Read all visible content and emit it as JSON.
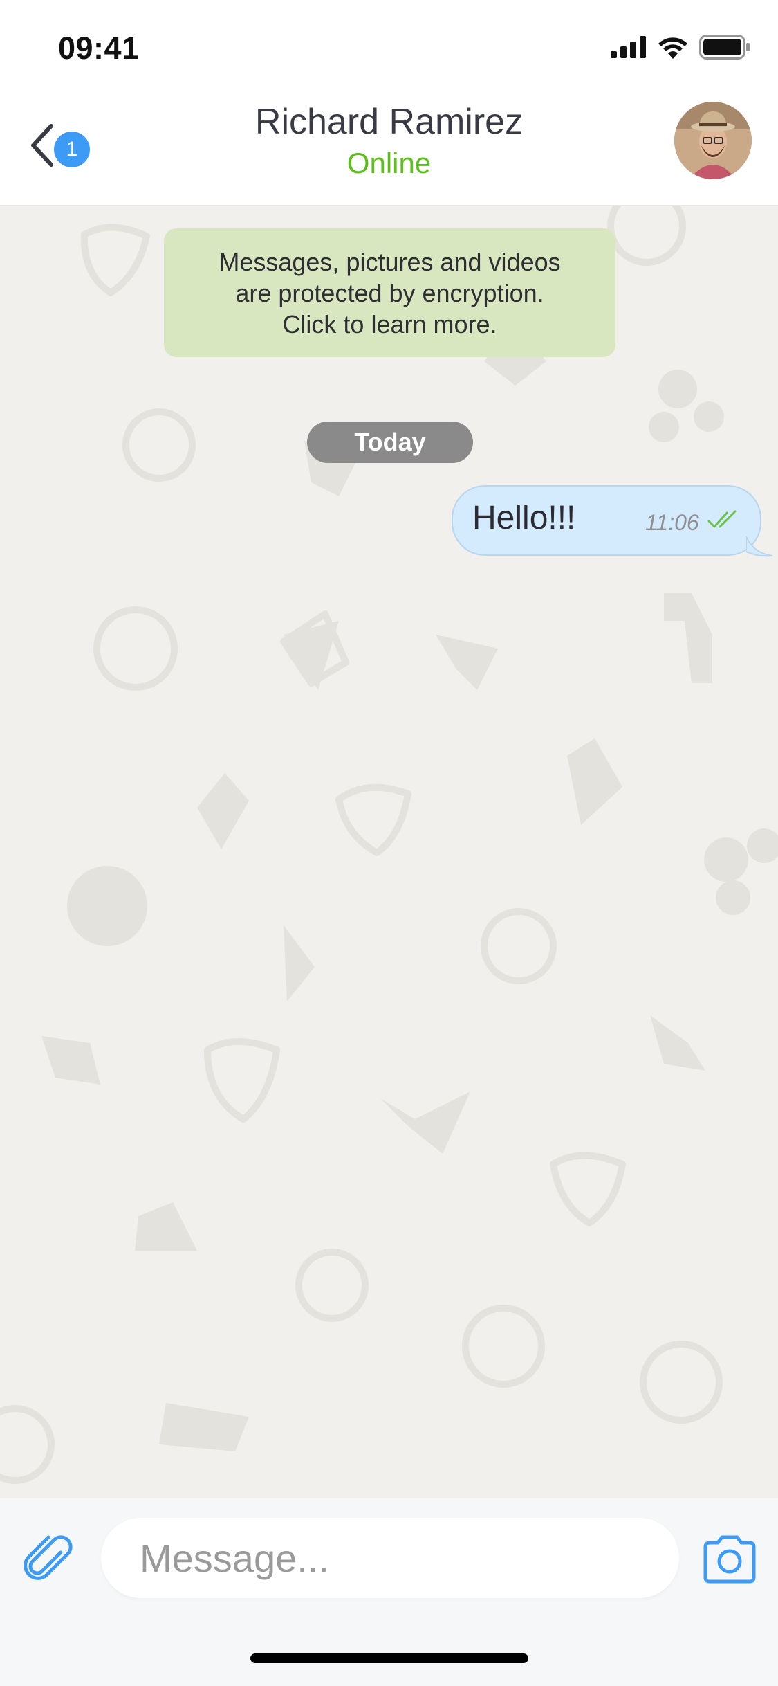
{
  "status_bar": {
    "time": "09:41"
  },
  "header": {
    "back_badge_count": "1",
    "contact_name": "Richard Ramirez",
    "contact_status": "Online"
  },
  "chat": {
    "encryption_notice": {
      "line1": "Messages, pictures and videos",
      "line2": "are protected by encryption.",
      "line3": "Click to learn more."
    },
    "date_separator": "Today",
    "messages": [
      {
        "text": "Hello!!!",
        "time": "11:06",
        "status": "read",
        "direction": "outgoing"
      }
    ]
  },
  "composer": {
    "placeholder": "Message..."
  },
  "colors": {
    "accent_blue": "#3e9bf5",
    "online_green": "#5ebf1a",
    "outgoing_bubble": "#d4ebfd",
    "notice_bg": "#d9e7c0",
    "chat_bg": "#f1f0ec",
    "read_check": "#6cc24a"
  },
  "icons": {
    "back": "chevron-left-icon",
    "attach": "paperclip-icon",
    "camera": "camera-icon",
    "signal": "cellular-signal-icon",
    "wifi": "wifi-icon",
    "battery": "battery-icon",
    "read_receipt": "double-check-icon"
  }
}
